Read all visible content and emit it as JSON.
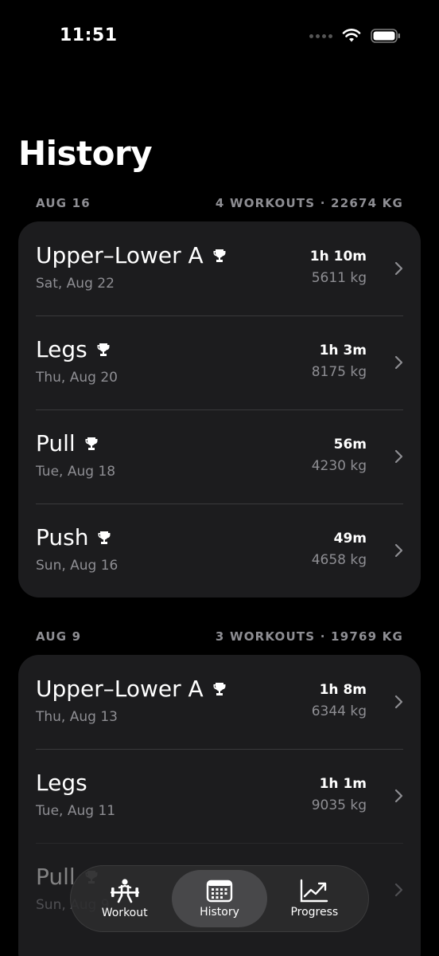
{
  "status": {
    "time": "11:51"
  },
  "title": "History",
  "sections": [
    {
      "date": "AUG 16",
      "summary": "4 WORKOUTS · 22674 KG",
      "workouts": [
        {
          "name": "Upper–Lower A",
          "date": "Sat, Aug 22",
          "duration": "1h 10m",
          "volume": "5611 kg",
          "trophy": true
        },
        {
          "name": "Legs",
          "date": "Thu, Aug 20",
          "duration": "1h 3m",
          "volume": "8175 kg",
          "trophy": true
        },
        {
          "name": "Pull",
          "date": "Tue, Aug 18",
          "duration": "56m",
          "volume": "4230 kg",
          "trophy": true
        },
        {
          "name": "Push",
          "date": "Sun, Aug 16",
          "duration": "49m",
          "volume": "4658 kg",
          "trophy": true
        }
      ]
    },
    {
      "date": "AUG 9",
      "summary": "3 WORKOUTS · 19769 KG",
      "workouts": [
        {
          "name": "Upper–Lower A",
          "date": "Thu, Aug 13",
          "duration": "1h 8m",
          "volume": "6344 kg",
          "trophy": true
        },
        {
          "name": "Legs",
          "date": "Tue, Aug 11",
          "duration": "1h 1m",
          "volume": "9035 kg",
          "trophy": false
        },
        {
          "name": "Pull",
          "date": "Sun, Aug 9",
          "duration": "",
          "volume": "",
          "trophy": true
        }
      ]
    }
  ],
  "tabs": [
    {
      "label": "Workout",
      "icon": "weightlifter-icon",
      "active": false
    },
    {
      "label": "History",
      "icon": "calendar-icon",
      "active": true
    },
    {
      "label": "Progress",
      "icon": "chart-line-icon",
      "active": false
    }
  ],
  "colors": {
    "background": "#000000",
    "card": "#1c1c1e",
    "secondary_text": "#8e8e93",
    "active_tab": "#48484a"
  }
}
